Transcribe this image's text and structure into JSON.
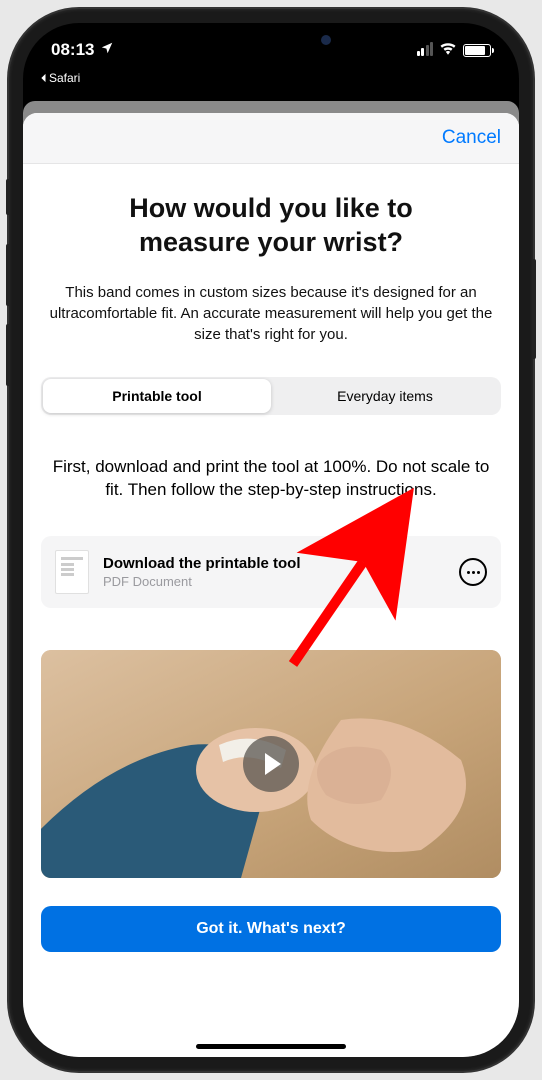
{
  "status": {
    "time": "08:13",
    "back_app": "Safari"
  },
  "sheet": {
    "cancel": "Cancel",
    "title": "How would you like to measure your wrist?",
    "subtitle": "This band comes in custom sizes because it's designed for an ultracomfortable fit. An accurate measurement will help you get the size that's right for you.",
    "segments": {
      "printable": "Printable tool",
      "everyday": "Everyday items"
    },
    "instruction": "First, download and print the tool at 100%. Do not scale to fit. Then follow the step-by-step instructions.",
    "download": {
      "title": "Download the printable tool",
      "subtitle": "PDF Document"
    },
    "cta": "Got it. What's next?"
  }
}
